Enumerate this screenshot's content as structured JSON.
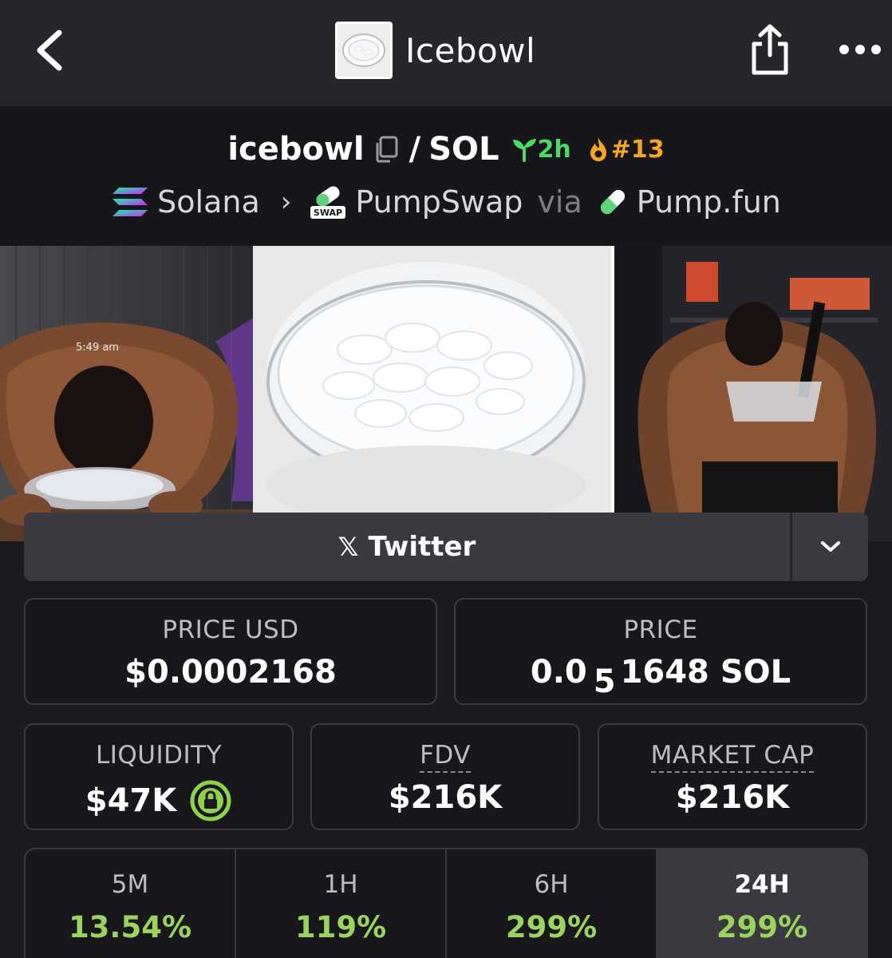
{
  "header": {
    "title": "Icebowl"
  },
  "pair": {
    "base": "icebowl",
    "separator": "/",
    "quote": "SOL",
    "age": "2h",
    "rank": "#13",
    "chain": "Solana",
    "dex": "PumpSwap",
    "dex_badge": "SWAP",
    "via_label": "via",
    "launchpad": "Pump.fun"
  },
  "banner": {
    "timestamp_overlay": "5:49 am"
  },
  "social": {
    "twitter_label": "Twitter"
  },
  "stats": {
    "price_usd_label": "PRICE USD",
    "price_usd": "$0.0002168",
    "price_label": "PRICE",
    "price_prefix": "0.0",
    "price_zero_count": "5",
    "price_suffix": "1648 SOL",
    "liquidity_label": "LIQUIDITY",
    "liquidity": "$47K",
    "fdv_label": "FDV",
    "fdv": "$216K",
    "mcap_label": "MARKET CAP",
    "mcap": "$216K"
  },
  "changes": [
    {
      "label": "5M",
      "value": "13.54%"
    },
    {
      "label": "1H",
      "value": "119%"
    },
    {
      "label": "6H",
      "value": "299%"
    },
    {
      "label": "24H",
      "value": "299%",
      "active": true
    }
  ],
  "colors": {
    "background": "#1a1a1f",
    "positive": "#9bd35f",
    "age_green": "#4cd964",
    "rank_orange": "#f5a623",
    "lock_green": "#8fd14f"
  }
}
